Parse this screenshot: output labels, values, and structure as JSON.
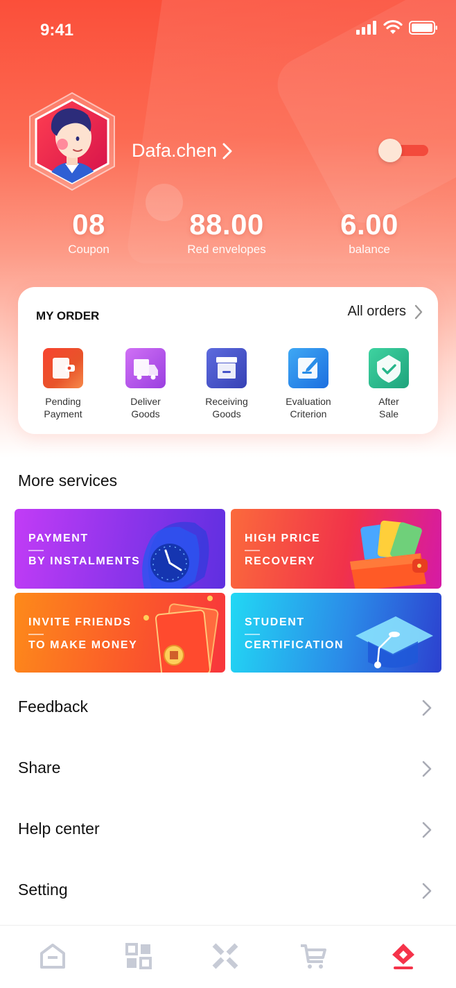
{
  "status_bar": {
    "time": "9:41"
  },
  "profile": {
    "username": "Dafa.chen",
    "toggle_on": true
  },
  "stats": [
    {
      "value": "08",
      "label": "Coupon"
    },
    {
      "value": "88.00",
      "label": "Red envelopes"
    },
    {
      "value": "6.00",
      "label": "balance"
    }
  ],
  "order": {
    "title": "MY ORDER",
    "all_label": "All orders",
    "items": [
      {
        "label": "Pending\nPayment",
        "icon": "wallet-icon",
        "color": "#f0462f"
      },
      {
        "label": "Deliver\nGoods",
        "icon": "truck-icon",
        "color": "#b057e8"
      },
      {
        "label": "Receiving\nGoods",
        "icon": "box-icon",
        "color": "#4553c9"
      },
      {
        "label": "Evaluation\nCriterion",
        "icon": "edit-icon",
        "color": "#2a8ee8"
      },
      {
        "label": "After\nSale",
        "icon": "shield-check-icon",
        "color": "#26b58a"
      }
    ]
  },
  "more_services": {
    "title": "More services",
    "cards": [
      {
        "line1": "PAYMENT",
        "line2": "BY INSTALMENTS",
        "icon": "clock-icon",
        "colors": [
          "#b53cf5",
          "#6a31e6"
        ]
      },
      {
        "line1": "HIGH PRICE",
        "line2": "RECOVERY",
        "icon": "wallet-cards-icon",
        "colors": [
          "#fb5a3c",
          "#e0239a"
        ]
      },
      {
        "line1": "INVITE FRIENDS",
        "line2": "TO MAKE MONEY",
        "icon": "red-envelope-icon",
        "colors": [
          "#fd8b1c",
          "#fb3a3a"
        ]
      },
      {
        "line1": "STUDENT",
        "line2": "CERTIFICATION",
        "icon": "graduation-cap-icon",
        "colors": [
          "#21d3f2",
          "#2a4ed6"
        ]
      }
    ]
  },
  "menu": [
    {
      "label": "Feedback"
    },
    {
      "label": "Share"
    },
    {
      "label": "Help center"
    },
    {
      "label": "Setting"
    }
  ],
  "tabbar": {
    "active_index": 4,
    "active_color": "#f5334a",
    "inactive_color": "#c7cbd6",
    "tabs": [
      {
        "icon": "home-icon"
      },
      {
        "icon": "grid-icon"
      },
      {
        "icon": "cross-icon"
      },
      {
        "icon": "cart-icon"
      },
      {
        "icon": "profile-diamond-icon"
      }
    ]
  }
}
